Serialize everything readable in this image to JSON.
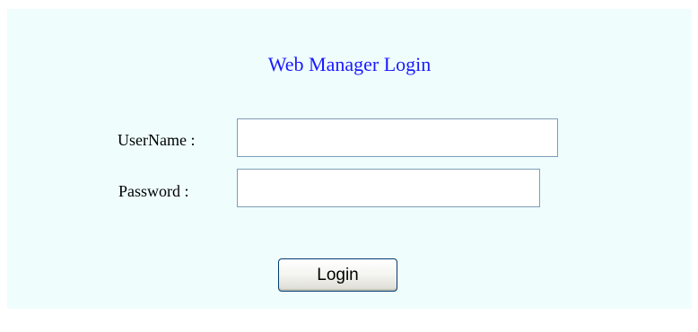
{
  "login": {
    "title": "Web Manager Login",
    "username_label": "UserName :",
    "username_value": "",
    "password_label": "Password :",
    "password_value": "",
    "login_button_label": "Login"
  },
  "colors": {
    "panel_background": "#effdfd",
    "title_color": "#1a1aff",
    "field_border": "#7f9db9"
  }
}
